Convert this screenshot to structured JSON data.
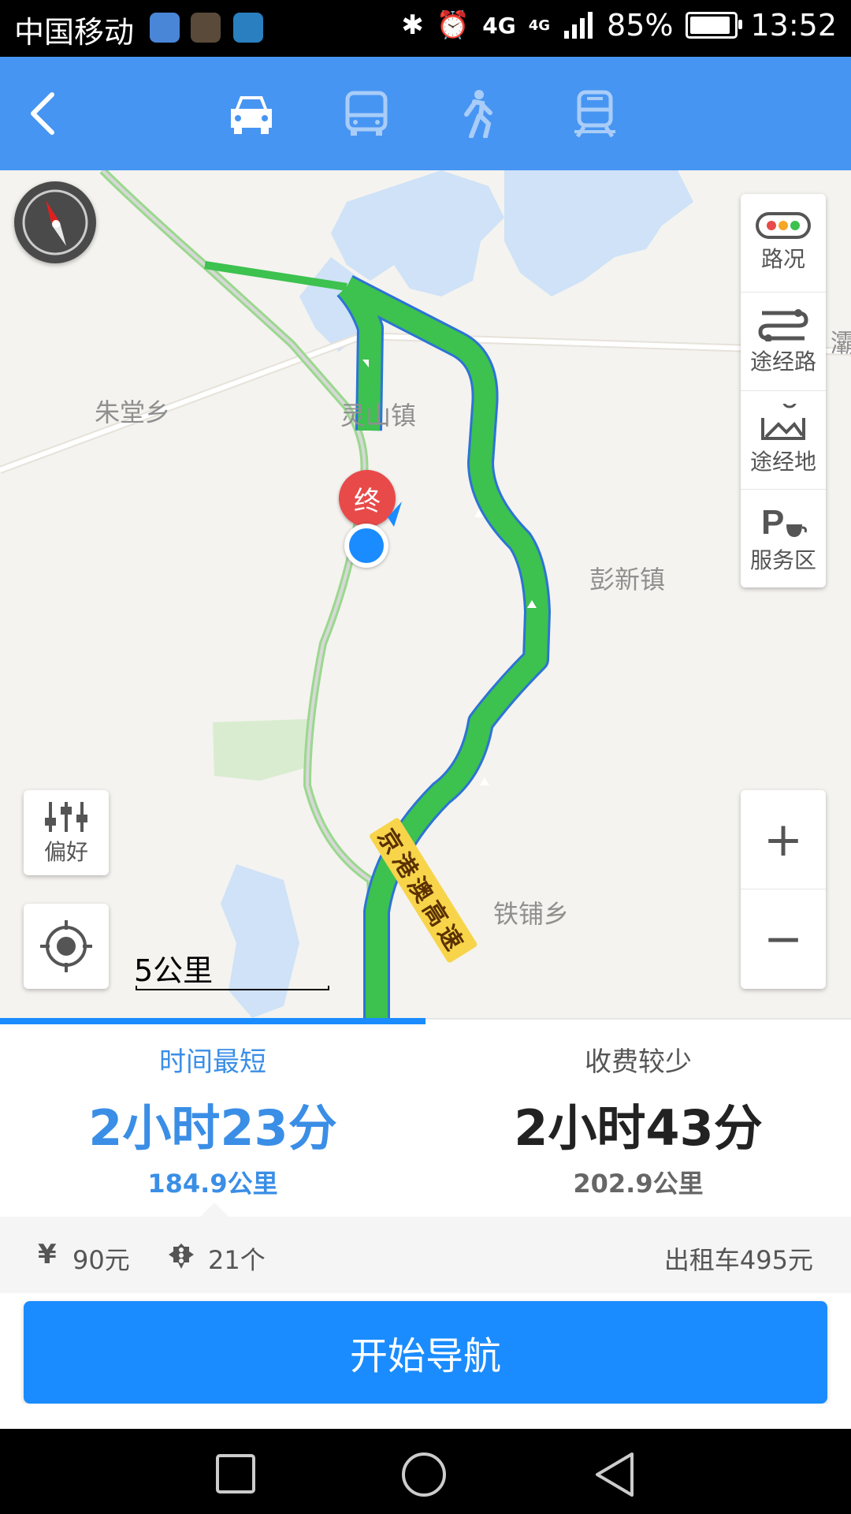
{
  "status_bar": {
    "carrier": "中国移动",
    "network": "4G",
    "network2": "4G",
    "battery": "85%",
    "battery_level": 0.85,
    "time": "13:52"
  },
  "top_nav": {
    "modes": [
      "car-icon",
      "bus-icon",
      "walk-icon",
      "train-icon"
    ],
    "active_mode": "car",
    "bg_color": "#4795f2"
  },
  "map": {
    "labels": {
      "zhutang": "朱堂乡",
      "lingshan": "灵山镇",
      "pengxin": "彭新镇",
      "tiepu": "铁铺乡",
      "edge_partial": "灞"
    },
    "end_marker": "终",
    "highway_label": "京港澳高速",
    "scale": "5公里",
    "right_controls": [
      {
        "label": "路况",
        "icon": "traffic-light-icon"
      },
      {
        "label": "途经路",
        "icon": "route-via-icon"
      },
      {
        "label": "途经地",
        "icon": "map-pin-icon"
      },
      {
        "label": "服务区",
        "icon": "service-area-icon"
      }
    ],
    "preference": "偏好",
    "zoom_in": "+",
    "zoom_out": "−"
  },
  "routes": [
    {
      "label": "时间最短",
      "time": "2小时23分",
      "distance": "184.9公里",
      "selected": true
    },
    {
      "label": "收费较少",
      "time": "2小时43分",
      "distance": "202.9公里",
      "selected": false
    }
  ],
  "info": {
    "toll_symbol": "¥",
    "toll": "90元",
    "lights": "21个",
    "taxi": "出租车495元"
  },
  "start_button": "开始导航",
  "colors": {
    "accent": "#1a8cff",
    "route_green": "#3dc14f",
    "selected_text": "#3a8ee6"
  }
}
